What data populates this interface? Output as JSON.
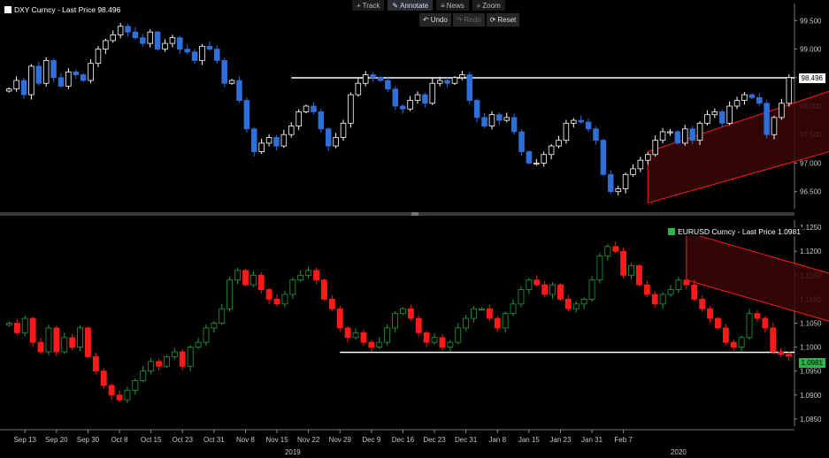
{
  "toolbar": {
    "items": [
      {
        "label": "Track",
        "icon": "crosshair-icon",
        "glyph": "+"
      },
      {
        "label": "Annotate",
        "icon": "pencil-icon",
        "glyph": "✎",
        "active": true
      },
      {
        "label": "News",
        "icon": "news-icon",
        "glyph": "≡"
      },
      {
        "label": "Zoom",
        "icon": "zoom-icon",
        "glyph": "⌕"
      }
    ],
    "actions": [
      {
        "label": "Undo",
        "icon": "undo-icon",
        "glyph": "↶"
      },
      {
        "label": "Redo",
        "icon": "redo-icon",
        "glyph": "↷",
        "disabled": true
      },
      {
        "label": "Reset",
        "icon": "reset-icon",
        "glyph": "⟳"
      }
    ]
  },
  "colors": {
    "up": "#ffffff",
    "down_top": "#2f6fd8",
    "down_bottom": "#ff1a1a",
    "up_bottom": "#1f9d3a",
    "channel": "#ff1a1a",
    "channel_fill": "#3a0606",
    "axis_text": "#c8c8c8",
    "label_box_top": "#ffffff",
    "label_box_bottom": "#2db34a"
  },
  "chart_data": [
    {
      "type": "candlestick",
      "title": "DXY Curncy - Last Price 98.496",
      "legend_marker": "white-square",
      "last_price": "98.496",
      "y_ticks": [
        "99.500",
        "99.000",
        "98.500",
        "98.000",
        "97.500",
        "97.000",
        "96.500"
      ],
      "y_range": [
        96.2,
        99.8
      ],
      "close": [
        98.3,
        98.45,
        98.2,
        98.7,
        98.4,
        98.8,
        98.5,
        98.35,
        98.6,
        98.55,
        98.45,
        98.75,
        99.0,
        99.15,
        99.25,
        99.4,
        99.3,
        99.2,
        99.1,
        99.3,
        99.0,
        99.1,
        99.2,
        99.0,
        98.95,
        98.8,
        99.05,
        99.0,
        98.8,
        98.4,
        98.45,
        98.1,
        97.6,
        97.2,
        97.35,
        97.45,
        97.3,
        97.5,
        97.65,
        97.9,
        98.0,
        97.9,
        97.6,
        97.3,
        97.45,
        97.7,
        98.2,
        98.4,
        98.55,
        98.5,
        98.45,
        98.3,
        98.0,
        97.95,
        98.1,
        98.2,
        98.05,
        98.4,
        98.45,
        98.4,
        98.5,
        98.55,
        98.1,
        97.8,
        97.65,
        97.85,
        97.75,
        97.8,
        97.55,
        97.2,
        97.0,
        97.0,
        97.15,
        97.3,
        97.4,
        97.7,
        97.75,
        97.72,
        97.6,
        97.4,
        96.8,
        96.5,
        96.55,
        96.8,
        96.9,
        97.05,
        97.15,
        97.4,
        97.55,
        97.55,
        97.35,
        97.6,
        97.4,
        97.7,
        97.85,
        97.9,
        97.7,
        98.0,
        98.1,
        98.2,
        98.15,
        98.05,
        97.5,
        97.8,
        98.05,
        98.5
      ],
      "bars_per_label": 4,
      "x_labels": [
        "Sep 13",
        "Sep 20",
        "Sep 30",
        "Oct 8",
        "Oct 15",
        "Oct 23",
        "Oct 31",
        "Nov 8",
        "Nov 15",
        "Nov 22",
        "Nov 29",
        "Dec 9",
        "Dec 16",
        "Dec 23",
        "Dec 31",
        "Jan 8",
        "Jan 15",
        "Jan 23",
        "Jan 31",
        "Feb 7"
      ],
      "x_years": [
        "2019",
        "2020"
      ],
      "support_line_value": 98.496,
      "channel": {
        "start_bar": 87,
        "end_bar": 124,
        "lower": [
          96.3,
          97.7
        ],
        "upper": [
          97.2,
          98.85
        ]
      }
    },
    {
      "type": "candlestick",
      "title": "EURUSD Curncy - Last Price 1.0981",
      "legend_marker": "green-square",
      "last_price": "1.0981",
      "y_ticks": [
        "1.1250",
        "1.1200",
        "1.1150",
        "1.1100",
        "1.1050",
        "1.1000",
        "1.0950",
        "1.0900",
        "1.0850"
      ],
      "y_range": [
        1.0835,
        1.1265
      ],
      "close": [
        1.105,
        1.103,
        1.106,
        1.101,
        1.099,
        1.104,
        1.099,
        1.102,
        1.1,
        1.104,
        1.098,
        1.095,
        1.092,
        1.09,
        1.089,
        1.091,
        1.093,
        1.095,
        1.097,
        1.096,
        1.098,
        1.099,
        1.096,
        1.1,
        1.101,
        1.104,
        1.105,
        1.108,
        1.114,
        1.116,
        1.113,
        1.115,
        1.112,
        1.11,
        1.109,
        1.111,
        1.114,
        1.115,
        1.116,
        1.114,
        1.11,
        1.108,
        1.104,
        1.102,
        1.103,
        1.101,
        1.1,
        1.101,
        1.104,
        1.107,
        1.108,
        1.106,
        1.103,
        1.101,
        1.102,
        1.1,
        1.101,
        1.104,
        1.106,
        1.108,
        1.108,
        1.106,
        1.104,
        1.107,
        1.109,
        1.112,
        1.114,
        1.113,
        1.111,
        1.113,
        1.11,
        1.108,
        1.109,
        1.11,
        1.114,
        1.119,
        1.121,
        1.12,
        1.115,
        1.117,
        1.113,
        1.111,
        1.109,
        1.111,
        1.112,
        1.114,
        1.113,
        1.11,
        1.108,
        1.106,
        1.104,
        1.101,
        1.1,
        1.102,
        1.107,
        1.106,
        1.104,
        1.099,
        1.0985,
        1.0981
      ],
      "bars_per_label": 4,
      "x_labels": [
        "Sep 13",
        "Sep 20",
        "Sep 30",
        "Oct 8",
        "Oct 15",
        "Oct 23",
        "Oct 31",
        "Nov 8",
        "Nov 15",
        "Nov 22",
        "Nov 29",
        "Dec 9",
        "Dec 16",
        "Dec 23",
        "Dec 31",
        "Jan 8",
        "Jan 15",
        "Jan 23",
        "Jan 31",
        "Feb 7"
      ],
      "x_years": [
        "2019",
        "2020"
      ],
      "support_line_value": 1.0989,
      "channel": {
        "start_bar": 87,
        "end_bar": 124,
        "lower": [
          1.114,
          1.096
        ],
        "upper": [
          1.124,
          1.106
        ]
      }
    }
  ]
}
